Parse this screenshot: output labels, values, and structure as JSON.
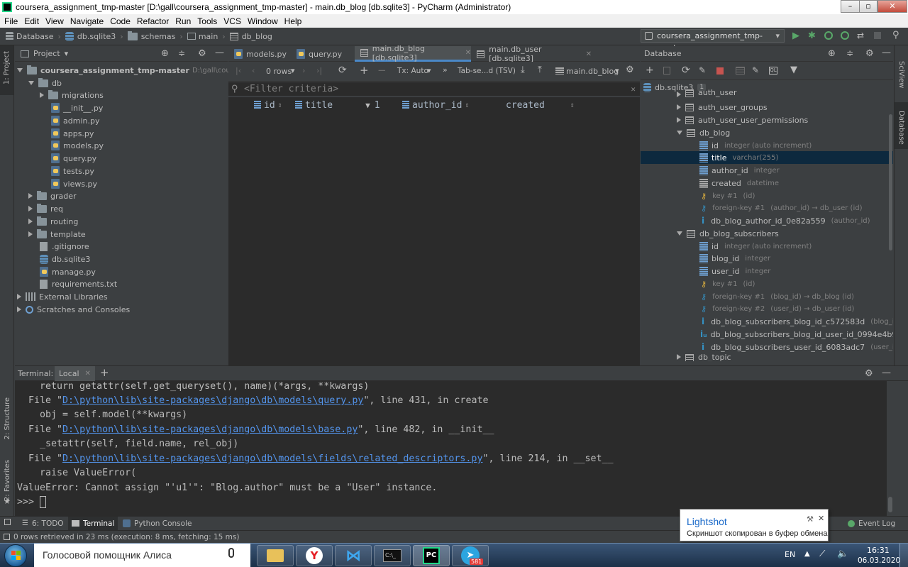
{
  "window": {
    "title": "coursera_assignment_tmp-master [D:\\gall\\coursera_assignment_tmp-master] - main.db_blog [db.sqlite3] - PyCharm (Administrator)"
  },
  "menu": [
    "File",
    "Edit",
    "View",
    "Navigate",
    "Code",
    "Refactor",
    "Run",
    "Tools",
    "VCS",
    "Window",
    "Help"
  ],
  "breadcrumb": [
    "Database",
    "db.sqlite3",
    "schemas",
    "main",
    "db_blog"
  ],
  "run_config": "coursera_assignment_tmp-master",
  "left_stripe": {
    "project": "1: Project",
    "structure": "2: Structure",
    "favorites": "2: Favorites"
  },
  "right_stripe": {
    "sciview": "SciView",
    "database": "Database"
  },
  "project_panel": {
    "title": "Project",
    "root": {
      "name": "coursera_assignment_tmp-master",
      "path": "D:\\gall\\coursera_ass"
    },
    "items": [
      {
        "name": "db",
        "kind": "folder",
        "open": true
      },
      {
        "name": "migrations",
        "kind": "folder",
        "open": false
      },
      {
        "name": "__init__.py",
        "kind": "py"
      },
      {
        "name": "admin.py",
        "kind": "py"
      },
      {
        "name": "apps.py",
        "kind": "py"
      },
      {
        "name": "models.py",
        "kind": "py"
      },
      {
        "name": "query.py",
        "kind": "py"
      },
      {
        "name": "tests.py",
        "kind": "py"
      },
      {
        "name": "views.py",
        "kind": "py"
      },
      {
        "name": "grader",
        "kind": "folder",
        "open": false
      },
      {
        "name": "req",
        "kind": "folder",
        "open": false
      },
      {
        "name": "routing",
        "kind": "folder",
        "open": false
      },
      {
        "name": "template",
        "kind": "folder",
        "open": false
      },
      {
        "name": ".gitignore",
        "kind": "txt"
      },
      {
        "name": "db.sqlite3",
        "kind": "db"
      },
      {
        "name": "manage.py",
        "kind": "py"
      },
      {
        "name": "requirements.txt",
        "kind": "txt"
      },
      {
        "name": "External Libraries",
        "kind": "lib"
      },
      {
        "name": "Scratches and Consoles",
        "kind": "scratch"
      }
    ]
  },
  "editor_tabs": [
    {
      "label": "models.py",
      "active": false
    },
    {
      "label": "query.py",
      "active": false
    },
    {
      "label": "main.db_blog [db.sqlite3]",
      "active": true
    },
    {
      "label": "main.db_user [db.sqlite3]",
      "active": false
    }
  ],
  "grid_toolbar": {
    "rows": "0 rows",
    "tx": "Tx: Auto",
    "format": "Tab-se...d (TSV)",
    "table": "main.db_blog"
  },
  "filter_placeholder": "<Filter criteria>",
  "grid_columns": [
    {
      "name": "id"
    },
    {
      "name": "title",
      "sort": "1"
    },
    {
      "name": "author_id"
    },
    {
      "name": "created"
    }
  ],
  "database_panel": {
    "title": "Database",
    "root": "db.sqlite3",
    "root_count": "1",
    "items": [
      {
        "label": "auth_user",
        "kind": "table"
      },
      {
        "label": "auth_user_groups",
        "kind": "table"
      },
      {
        "label": "auth_user_user_permissions",
        "kind": "table"
      },
      {
        "label": "db_blog",
        "kind": "table"
      },
      {
        "label": "id",
        "kind": "column",
        "detail": "integer (auto increment)"
      },
      {
        "label": "title",
        "kind": "column",
        "detail": "varchar(255)"
      },
      {
        "label": "author_id",
        "kind": "column",
        "detail": "integer"
      },
      {
        "label": "created",
        "kind": "column",
        "detail": "datetime"
      },
      {
        "label": "key #1",
        "kind": "key",
        "detail": "(id)"
      },
      {
        "label": "foreign-key #1",
        "kind": "fkey",
        "detail": "(author_id) → db_user (id)"
      },
      {
        "label": "db_blog_author_id_0e82a559",
        "kind": "index",
        "detail": "(author_id)"
      },
      {
        "label": "db_blog_subscribers",
        "kind": "table"
      },
      {
        "label": "id",
        "kind": "column",
        "detail": "integer (auto increment)"
      },
      {
        "label": "blog_id",
        "kind": "column",
        "detail": "integer"
      },
      {
        "label": "user_id",
        "kind": "column",
        "detail": "integer"
      },
      {
        "label": "key #1",
        "kind": "key",
        "detail": "(id)"
      },
      {
        "label": "foreign-key #1",
        "kind": "fkey",
        "detail": "(blog_id) → db_blog (id)"
      },
      {
        "label": "foreign-key #2",
        "kind": "fkey",
        "detail": "(user_id) → db_user (id)"
      },
      {
        "label": "db_blog_subscribers_blog_id_c572583d",
        "kind": "index",
        "detail": "(blog_id)"
      },
      {
        "label": "db_blog_subscribers_blog_id_user_id_0994e4b9_uniq",
        "kind": "index",
        "detail": ""
      },
      {
        "label": "db_blog_subscribers_user_id_6083adc7",
        "kind": "index",
        "detail": "(user_id)"
      },
      {
        "label": "db_topic",
        "kind": "table"
      }
    ]
  },
  "terminal": {
    "label": "Terminal:",
    "tab": "Local",
    "lines": [
      {
        "pre": "    return getattr(self.get_queryset(), name)(*args, **kwargs)",
        "link": "",
        "post": ""
      },
      {
        "pre": "  File \"",
        "link": "D:\\python\\lib\\site-packages\\django\\db\\models\\query.py",
        "post": "\", line 431, in create"
      },
      {
        "pre": "    obj = self.model(**kwargs)",
        "link": "",
        "post": ""
      },
      {
        "pre": "  File \"",
        "link": "D:\\python\\lib\\site-packages\\django\\db\\models\\base.py",
        "post": "\", line 482, in __init__"
      },
      {
        "pre": "    _setattr(self, field.name, rel_obj)",
        "link": "",
        "post": ""
      },
      {
        "pre": "  File \"",
        "link": "D:\\python\\lib\\site-packages\\django\\db\\models\\fields\\related_descriptors.py",
        "post": "\", line 214, in __set__"
      },
      {
        "pre": "    raise ValueError(",
        "link": "",
        "post": ""
      },
      {
        "pre": "ValueError: Cannot assign \"'u1'\": \"Blog.author\" must be a \"User\" instance.",
        "link": "",
        "post": ""
      },
      {
        "pre": ">>> ",
        "link": "",
        "post": ""
      }
    ]
  },
  "bottom_tools": {
    "todo": "6: TODO",
    "terminal": "Terminal",
    "python_console": "Python Console",
    "event_log": "Event Log"
  },
  "status": "0 rows retrieved in 23 ms (execution: 8 ms, fetching: 15 ms)",
  "lightshot": {
    "title": "Lightshot",
    "message": "Скриншот скопирован в буфер обмена"
  },
  "taskbar": {
    "search": "Голосовой помощник Алиса",
    "lang": "EN",
    "time": "16:31",
    "date": "06.03.2020",
    "telegram_badge": "581"
  },
  "colors": {
    "accent": "#4a88c7",
    "link": "#5394ec",
    "selection": "#0d293e",
    "key": "#e8b73e",
    "editor_bg": "#2b2b2b",
    "panel_bg": "#3c3f41"
  }
}
